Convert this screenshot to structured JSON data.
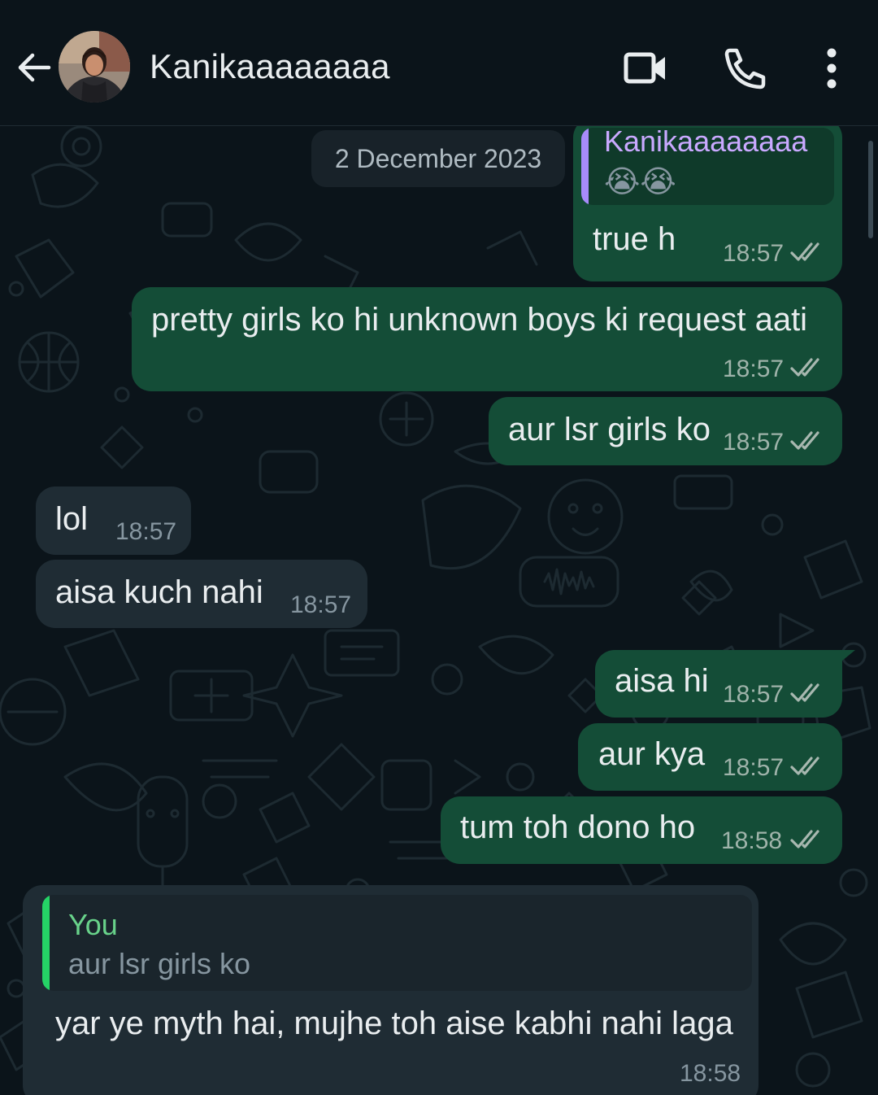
{
  "header": {
    "contact_name": "Kanikaaaaaaaa",
    "icons": {
      "back": "arrow-left-icon",
      "video": "video-camera-icon",
      "call": "phone-icon",
      "menu": "more-vertical-icon"
    }
  },
  "chat": {
    "date_chip": "2 December 2023",
    "messages": [
      {
        "direction": "outgoing",
        "quote_author": "Kanikaaaaaaaa",
        "quote_text": "😭😭",
        "text": "true h",
        "time": "18:57",
        "status": "read"
      },
      {
        "direction": "outgoing",
        "text": "pretty girls ko hi unknown boys ki request aati",
        "time": "18:57",
        "status": "read"
      },
      {
        "direction": "outgoing",
        "text": "aur lsr girls ko",
        "time": "18:57",
        "status": "read"
      },
      {
        "direction": "incoming",
        "text": "lol",
        "time": "18:57"
      },
      {
        "direction": "incoming",
        "text": "aisa kuch nahi",
        "time": "18:57"
      },
      {
        "direction": "outgoing",
        "text": "aisa hi",
        "time": "18:57",
        "status": "read"
      },
      {
        "direction": "outgoing",
        "text": "aur kya",
        "time": "18:57",
        "status": "read"
      },
      {
        "direction": "outgoing",
        "text": "tum toh dono ho",
        "time": "18:58",
        "status": "read"
      },
      {
        "direction": "incoming",
        "quote_author": "You",
        "quote_text": "aur lsr girls ko",
        "text": "yar ye myth hai, mujhe toh aise kabhi nahi laga",
        "time": "18:58"
      }
    ]
  },
  "colors": {
    "background": "#0b141a",
    "outgoing_bubble": "#144d37",
    "incoming_bubble": "#1f2c34",
    "read_ticks": "#a8b8b0",
    "quote_bar_contact": "#a78bfa",
    "quote_bar_you": "#25d366",
    "quote_author_you": "#68d28a",
    "quote_author_contact": "#c9a9ff"
  }
}
